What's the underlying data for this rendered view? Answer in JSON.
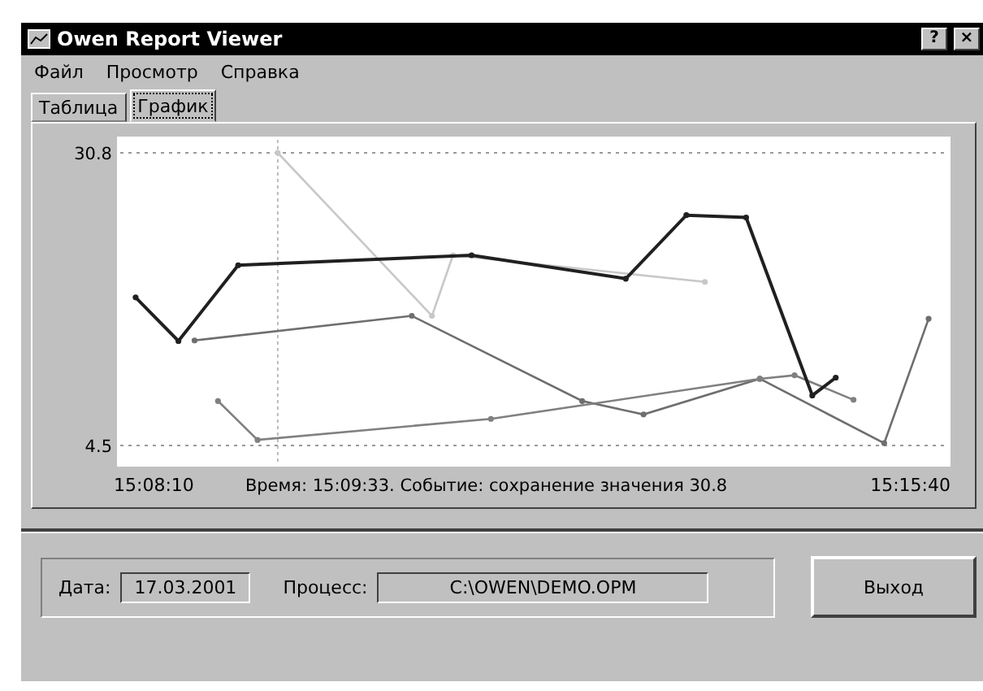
{
  "window": {
    "title": "Owen Report Viewer",
    "buttons": [
      "?",
      "×"
    ]
  },
  "menu": [
    "Файл",
    "Просмотр",
    "Справка"
  ],
  "tabs": [
    {
      "label": "Таблица",
      "selected": false
    },
    {
      "label": "График",
      "selected": true
    }
  ],
  "chart": {
    "status": "Время: 15:09:33. Событие: сохранение значения 30.8",
    "y_labels": [
      "30.8",
      "4.5"
    ],
    "time_labels": [
      "15:08:10",
      "15:15:40"
    ]
  },
  "footer": {
    "date_label": "Дата:",
    "date": "17.03.2001",
    "process_label": "Процесс:",
    "process": "C:\\OWEN\\DEMO.OPM",
    "exit": "Выход"
  }
}
